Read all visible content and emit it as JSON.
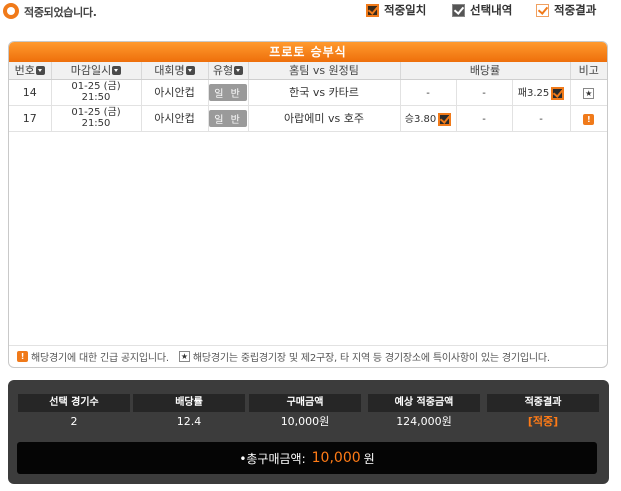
{
  "status": {
    "hit_message": "적중되었습니다."
  },
  "legend": {
    "hit": "적중일치",
    "selected": "선택내역",
    "result": "적중결과"
  },
  "panel": {
    "title": "프로토 승부식"
  },
  "columns": {
    "number": "번호",
    "deadline": "마감일시",
    "league": "대회명",
    "type": "유형",
    "teams": "홈팀 vs 원정팀",
    "odds": "배당률",
    "remark": "비고"
  },
  "rows": [
    {
      "number": "14",
      "date": "01-25 (금)",
      "time": "21:50",
      "league": "아시안컵",
      "type": "일 반",
      "teams": "한국 vs 카타르",
      "odds_win": "-",
      "odds_draw": "-",
      "odds_loss": "패3.25",
      "selected": "loss",
      "remark": "star"
    },
    {
      "number": "17",
      "date": "01-25 (금)",
      "time": "21:50",
      "league": "아시안컵",
      "type": "일 반",
      "teams": "아랍에미 vs 호주",
      "odds_win": "승3.80",
      "odds_draw": "-",
      "odds_loss": "-",
      "selected": "win",
      "remark": "alert"
    }
  ],
  "notes": {
    "alert_note": "해당경기에 대한 긴급 공지입니다.",
    "star_note": "해당경기는 중립경기장 및 제2구장, 타 지역 등 경기장소에 특이사항이 있는 경기입니다."
  },
  "summary": {
    "headers": [
      "선택 경기수",
      "배당률",
      "구매금액",
      "예상 적중금액",
      "적중결과"
    ],
    "values": [
      "2",
      "12.4",
      "10,000원",
      "124,000원",
      "[적중]"
    ],
    "total_label": "•총구매금액:",
    "total_amount": "10,000",
    "total_unit": "원"
  },
  "colors": {
    "accent": "#f07a1a",
    "dark": "#3c3c3c"
  }
}
